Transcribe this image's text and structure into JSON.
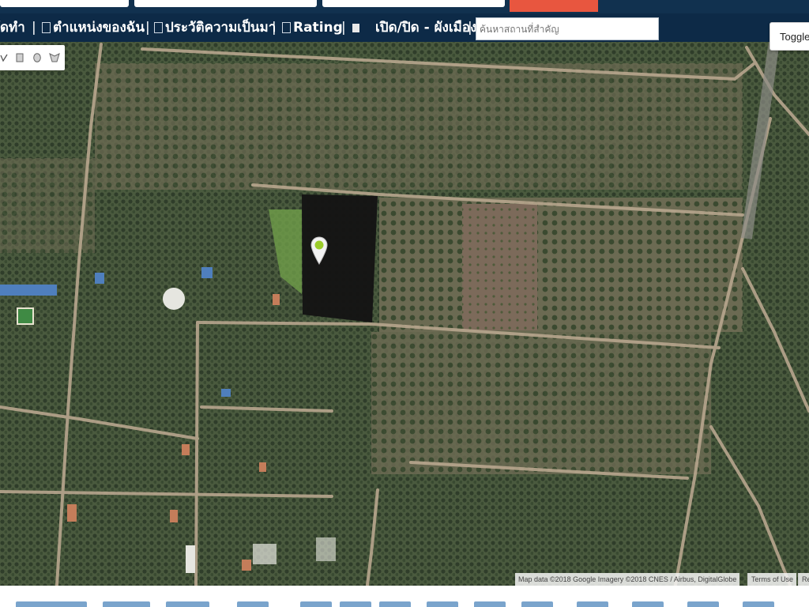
{
  "nav": {
    "items": [
      {
        "label": "ัดทำ"
      },
      {
        "label": "ตำแหน่งของฉัน"
      },
      {
        "label": "ประวัติความเป็นมา"
      },
      {
        "label": "Rating"
      },
      {
        "label": "เปิด/ปิด - ผังเมือง"
      }
    ],
    "separator": "|",
    "search_placeholder": "ค้นหาสถานที่สำคัญ"
  },
  "toggle_button": "Toggle",
  "map": {
    "attribution": "Map data ©2018 Google Imagery ©2018 CNES / Airbus, DigitalGlobe",
    "terms": "Terms of Use",
    "report": "Re"
  },
  "colors": {
    "navbar": "#0d2a47",
    "top_button": "#e8563f",
    "parcel": "#141414",
    "marker": "#9bcc2a"
  },
  "icons": [
    "pencil-icon",
    "rectangle-icon",
    "circle-icon",
    "polygon-icon",
    "map-pin-icon"
  ]
}
